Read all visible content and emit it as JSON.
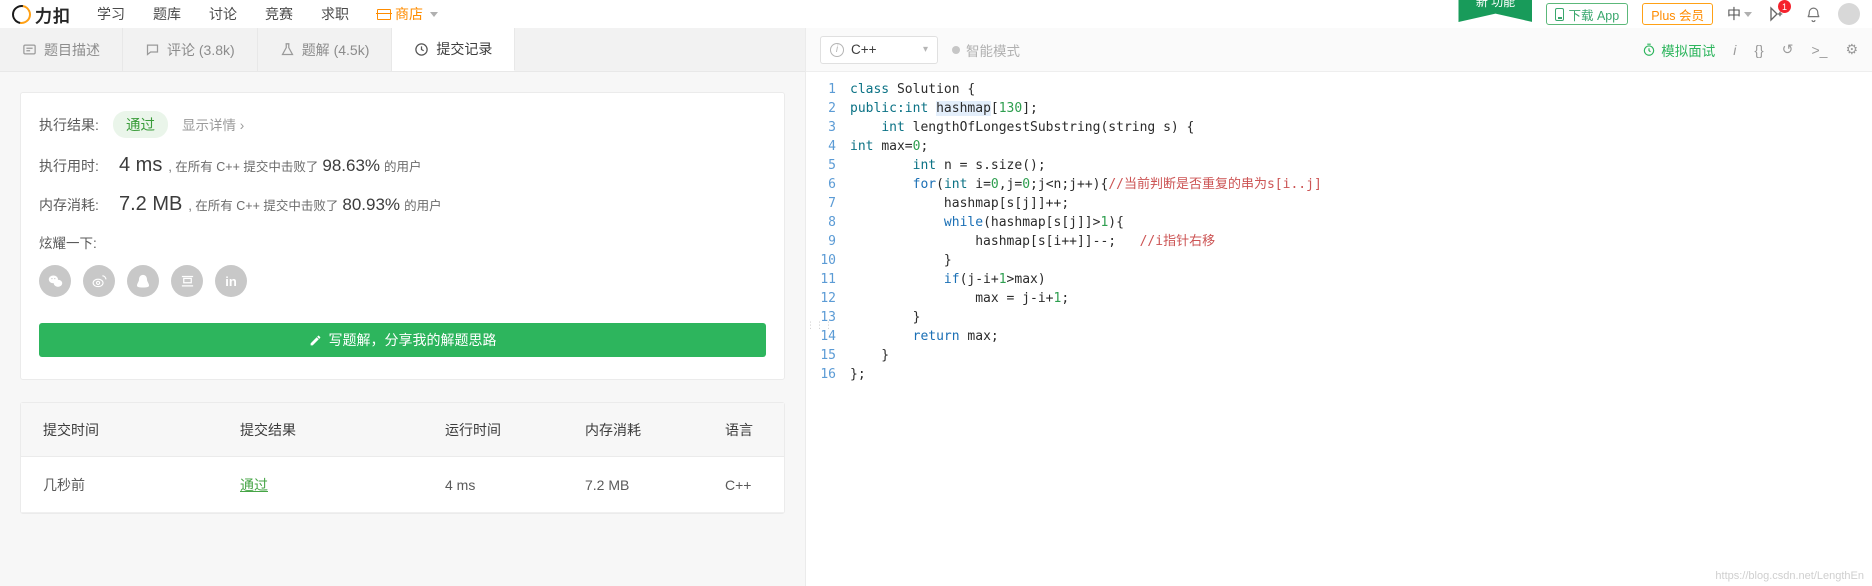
{
  "nav": {
    "brand": "力扣",
    "links": [
      {
        "label": "学习",
        "icon": ""
      },
      {
        "label": "题库",
        "icon": ""
      },
      {
        "label": "讨论",
        "icon": ""
      },
      {
        "label": "竞赛",
        "icon": ""
      },
      {
        "label": "求职",
        "icon": ""
      },
      {
        "label": "商店",
        "icon": "shop-icon"
      }
    ],
    "ribbon": "新 功能",
    "download_app": "下载 App",
    "plus": "Plus 会员",
    "lang": "中",
    "notification_badge": "1",
    "colors": {
      "brand_orange": "#ffa116",
      "green": "#2db55d"
    }
  },
  "tabs": [
    {
      "label": "题目描述",
      "icon": "description-icon",
      "active": false
    },
    {
      "label": "评论 (3.8k)",
      "icon": "comment-icon",
      "active": false
    },
    {
      "label": "题解 (4.5k)",
      "icon": "flask-icon",
      "active": false
    },
    {
      "label": "提交记录",
      "icon": "clock-icon",
      "active": true
    }
  ],
  "result": {
    "result_label": "执行结果:",
    "status": "通过",
    "detail_link": "显示详情 ›",
    "runtime_label": "执行用时:",
    "runtime_value": "4 ms",
    "runtime_text_before": ", 在所有 C++ 提交中击败了",
    "runtime_pct": "98.63%",
    "runtime_text_after": "的用户",
    "memory_label": "内存消耗:",
    "memory_value": "7.2 MB",
    "memory_text_before": ", 在所有 C++ 提交中击败了",
    "memory_pct": "80.93%",
    "memory_text_after": "的用户",
    "share_label": "炫耀一下:",
    "share_icons": [
      "wechat-icon",
      "weibo-icon",
      "qq-icon",
      "douban-icon",
      "linkedin-icon"
    ],
    "write_solution_button": "写题解，分享我的解题思路"
  },
  "table": {
    "headers": [
      "提交时间",
      "提交结果",
      "运行时间",
      "内存消耗",
      "语言"
    ],
    "rows": [
      {
        "time": "几秒前",
        "result": "通过",
        "runtime": "4 ms",
        "memory": "7.2 MB",
        "language": "C++"
      }
    ]
  },
  "editor": {
    "language": "C++",
    "smart_mode": "智能模式",
    "mock_interview": "模拟面试",
    "tools": [
      "info-icon",
      "braces-icon",
      "undo-icon",
      "console-icon",
      "settings-icon"
    ],
    "watermark": "https://blog.csdn.net/LengthEn",
    "lines": [
      {
        "n": 1,
        "tokens": [
          {
            "t": "class ",
            "c": "kw"
          },
          {
            "t": "Solution {",
            "c": ""
          }
        ]
      },
      {
        "n": 2,
        "tokens": [
          {
            "t": "public:",
            "c": "kw"
          },
          {
            "t": "int ",
            "c": "kw"
          },
          {
            "t": "hashmap",
            "c": "hl"
          },
          {
            "t": "[",
            "c": ""
          },
          {
            "t": "130",
            "c": "num"
          },
          {
            "t": "];",
            "c": ""
          }
        ]
      },
      {
        "n": 3,
        "tokens": [
          {
            "t": "    ",
            "c": ""
          },
          {
            "t": "int ",
            "c": "kw"
          },
          {
            "t": "lengthOfLongestSubstring(string s) {",
            "c": ""
          }
        ]
      },
      {
        "n": 4,
        "tokens": [
          {
            "t": "int ",
            "c": "kw"
          },
          {
            "t": "max=",
            "c": ""
          },
          {
            "t": "0",
            "c": "num"
          },
          {
            "t": ";",
            "c": ""
          }
        ]
      },
      {
        "n": 5,
        "tokens": [
          {
            "t": "        ",
            "c": ""
          },
          {
            "t": "int ",
            "c": "kw"
          },
          {
            "t": "n = s.size();",
            "c": ""
          }
        ]
      },
      {
        "n": 6,
        "tokens": [
          {
            "t": "        ",
            "c": ""
          },
          {
            "t": "for",
            "c": "kw2"
          },
          {
            "t": "(",
            "c": ""
          },
          {
            "t": "int ",
            "c": "kw"
          },
          {
            "t": "i=",
            "c": ""
          },
          {
            "t": "0",
            "c": "num"
          },
          {
            "t": ",j=",
            "c": ""
          },
          {
            "t": "0",
            "c": "num"
          },
          {
            "t": ";j<n;j++){",
            "c": ""
          },
          {
            "t": "//当前判断是否重复的串为s[i..j]",
            "c": "cmt"
          }
        ]
      },
      {
        "n": 7,
        "tokens": [
          {
            "t": "            hashmap[s[j]]++;",
            "c": ""
          }
        ]
      },
      {
        "n": 8,
        "tokens": [
          {
            "t": "            ",
            "c": ""
          },
          {
            "t": "while",
            "c": "kw2"
          },
          {
            "t": "(hashmap[s[j]]>",
            "c": ""
          },
          {
            "t": "1",
            "c": "num"
          },
          {
            "t": "){",
            "c": ""
          }
        ]
      },
      {
        "n": 9,
        "tokens": [
          {
            "t": "                hashmap[s[i++]]--;   ",
            "c": ""
          },
          {
            "t": "//i指针右移",
            "c": "cmt"
          }
        ]
      },
      {
        "n": 10,
        "tokens": [
          {
            "t": "            }",
            "c": ""
          }
        ]
      },
      {
        "n": 11,
        "tokens": [
          {
            "t": "            ",
            "c": ""
          },
          {
            "t": "if",
            "c": "kw2"
          },
          {
            "t": "(j-i+",
            "c": ""
          },
          {
            "t": "1",
            "c": "num"
          },
          {
            "t": ">max)",
            "c": ""
          }
        ]
      },
      {
        "n": 12,
        "tokens": [
          {
            "t": "                max = j-i+",
            "c": ""
          },
          {
            "t": "1",
            "c": "num"
          },
          {
            "t": ";",
            "c": ""
          }
        ]
      },
      {
        "n": 13,
        "tokens": [
          {
            "t": "        }",
            "c": ""
          }
        ]
      },
      {
        "n": 14,
        "tokens": [
          {
            "t": "        ",
            "c": ""
          },
          {
            "t": "return ",
            "c": "kw2"
          },
          {
            "t": "max;",
            "c": ""
          }
        ]
      },
      {
        "n": 15,
        "tokens": [
          {
            "t": "    }",
            "c": ""
          }
        ]
      },
      {
        "n": 16,
        "tokens": [
          {
            "t": "};",
            "c": ""
          }
        ]
      }
    ]
  }
}
